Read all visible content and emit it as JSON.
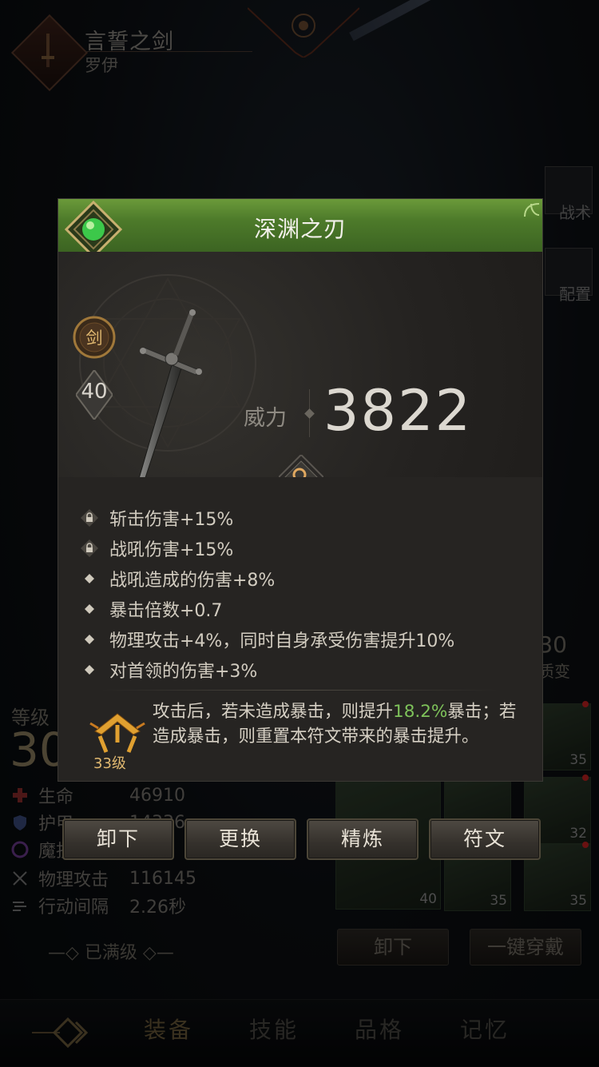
{
  "background": {
    "header": {
      "title": "言誓之剑",
      "subtitle": "罗伊"
    },
    "side_tabs": [
      "战术",
      "配置"
    ],
    "side_counter": {
      "value": "30",
      "label": "质变"
    },
    "stats": {
      "level_label": "等级",
      "level_value": "30",
      "rows": [
        {
          "label": "生命",
          "value": "46910",
          "icon": "cross-icon"
        },
        {
          "label": "护甲",
          "value": "14336",
          "icon": "shield-icon"
        },
        {
          "label": "魔抗",
          "value": "…",
          "icon": "swirl-icon"
        },
        {
          "label": "物理攻击",
          "value": "116145",
          "icon": "swords-icon"
        },
        {
          "label": "行动间隔",
          "value": "2.26秒",
          "icon": "wind-icon"
        }
      ],
      "maxed_label": "已满级"
    },
    "equip_slots": [
      {
        "level": "35"
      },
      {
        "level": "32"
      },
      {
        "level": "35"
      },
      {
        "level": "40"
      },
      {
        "level": "35"
      },
      {
        "level": "35"
      }
    ],
    "unequip_label": "卸下",
    "equip_all_label": "一键穿戴",
    "bottom_nav": [
      "装备",
      "技能",
      "品格",
      "记忆"
    ],
    "bottom_nav_active": "装备"
  },
  "item_card": {
    "name": "深渊之刃",
    "header_color": "#5a8a30",
    "type_badge": "剑",
    "level": "40",
    "power_label": "威力",
    "power_value": "3822",
    "attributes": [
      {
        "text": "斩击伤害+15%",
        "locked": true
      },
      {
        "text": "战吼伤害+15%",
        "locked": true
      },
      {
        "text": "战吼造成的伤害+8%",
        "locked": false
      },
      {
        "text": "暴击倍数+0.7",
        "locked": false
      },
      {
        "text": "物理攻击+4%，同时自身承受伤害提升10%",
        "locked": false
      },
      {
        "text": "对首领的伤害+3%",
        "locked": false
      }
    ],
    "rune": {
      "level": "33级",
      "text_before": "攻击后，若未造成暴击，则提升",
      "highlight": "18.2%",
      "text_after": "暴击；若造成暴击，则重置本符文带来的暴击提升。",
      "highlight_color": "#7ec25a"
    }
  },
  "actions": [
    "卸下",
    "更换",
    "精炼",
    "符文"
  ]
}
